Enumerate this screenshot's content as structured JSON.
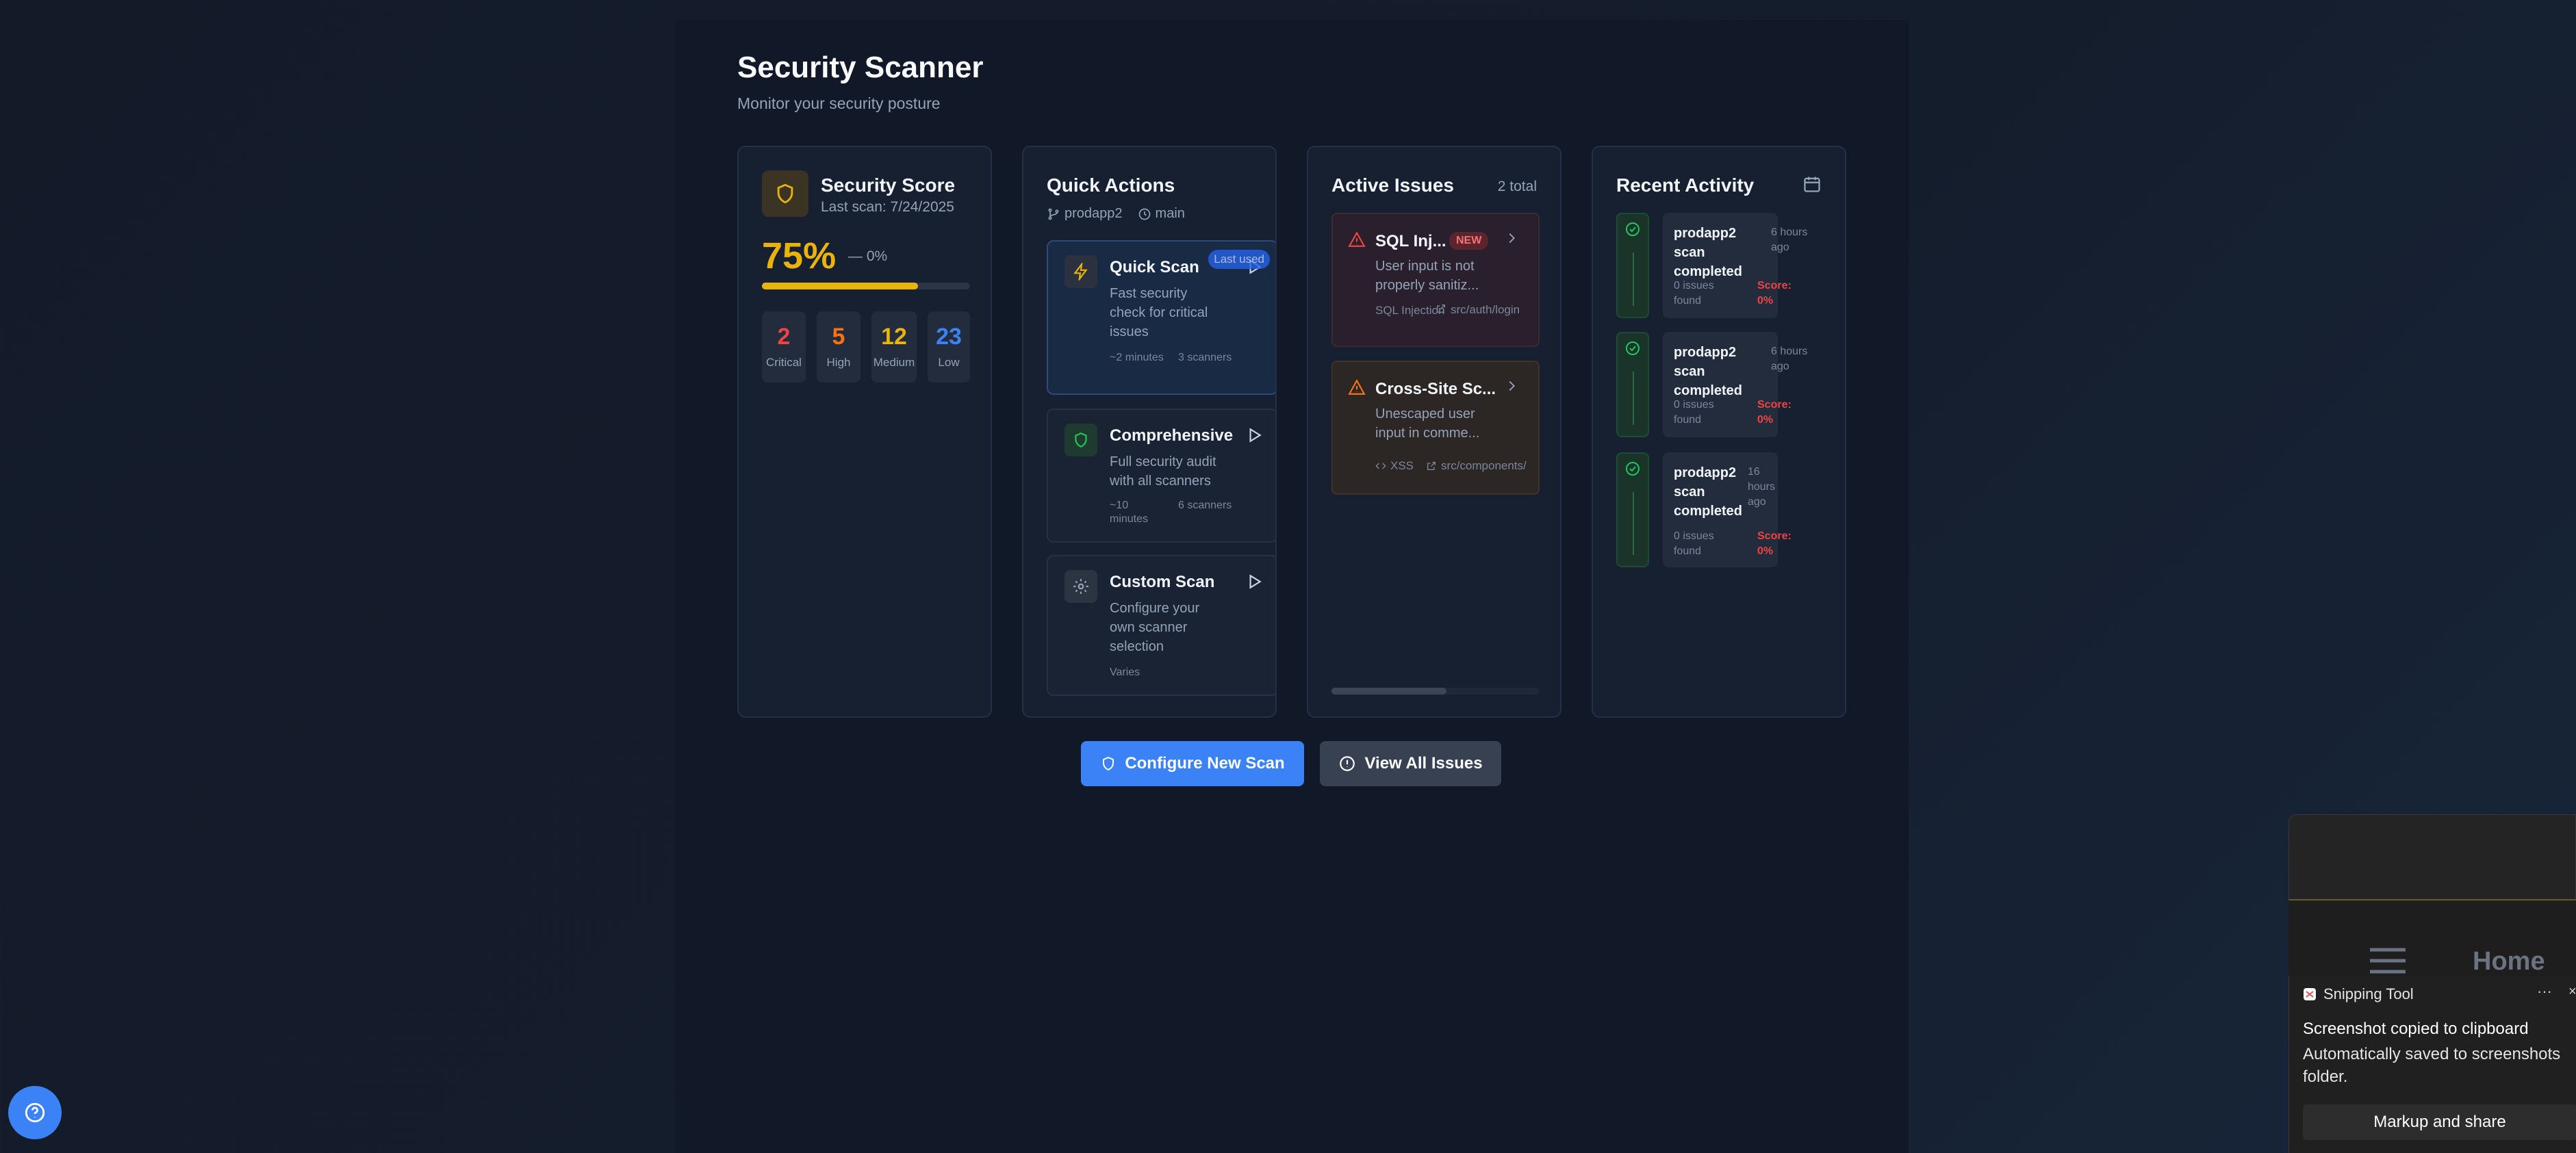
{
  "header": {
    "title": "Security Scanner",
    "subtitle": "Monitor your security posture"
  },
  "score_card": {
    "title": "Security Score",
    "last_scan": "Last scan: 7/24/2025",
    "score": "75%",
    "score_value": 0.75,
    "delta": "— 0%",
    "accent_color": "#eab308",
    "severity": [
      {
        "count": "2",
        "label": "Critical",
        "color": "#ef4444"
      },
      {
        "count": "5",
        "label": "High",
        "color": "#f97316"
      },
      {
        "count": "12",
        "label": "Medium",
        "color": "#eab308"
      },
      {
        "count": "23",
        "label": "Low",
        "color": "#3b82f6"
      }
    ]
  },
  "quick_actions": {
    "title": "Quick Actions",
    "repo": "prodapp2",
    "branch": "main",
    "items": [
      {
        "name": "Quick Scan",
        "desc": "Fast security check for critical issues",
        "time": "~2 minutes",
        "scanners": "3 scanners",
        "badge": "Last used",
        "icon": "lightning-icon"
      },
      {
        "name": "Comprehensive",
        "desc": "Full security audit with all scanners",
        "time": "~10 minutes",
        "scanners": "6 scanners",
        "icon": "shield-icon"
      },
      {
        "name": "Custom Scan",
        "desc": "Configure your own scanner selection",
        "time": "Varies",
        "icon": "gear-icon"
      }
    ]
  },
  "issues": {
    "title": "Active Issues",
    "total": "2 total",
    "items": [
      {
        "name": "SQL Inj...",
        "badge": "NEW",
        "desc": "User input is not properly sanitiz...",
        "type": "SQL Injection",
        "path": "src/auth/login",
        "color": "#ef4444"
      },
      {
        "name": "Cross-Site Sc...",
        "desc": "Unescaped user input in comme...",
        "type": "XSS",
        "path": "src/components/",
        "color": "#f97316"
      }
    ]
  },
  "activity": {
    "title": "Recent Activity",
    "items": [
      {
        "title": "prodapp2 scan completed",
        "time": "6 hours ago",
        "found": "0 issues found",
        "score": "Score: 0%"
      },
      {
        "title": "prodapp2 scan completed",
        "time": "6 hours ago",
        "found": "0 issues found",
        "score": "Score: 0%"
      },
      {
        "title": "prodapp2 scan completed",
        "time": "16 hours ago",
        "found": "0 issues found",
        "score": "Score: 0%"
      }
    ]
  },
  "buttons": {
    "configure": "Configure New Scan",
    "view_all": "View All Issues"
  },
  "toast": {
    "app": "Snipping Tool",
    "more": "···",
    "close": "×",
    "heading": "Screenshot copied to clipboard",
    "body": "Automatically saved to screenshots folder.",
    "action": "Markup and share",
    "behind_label": "Home"
  }
}
